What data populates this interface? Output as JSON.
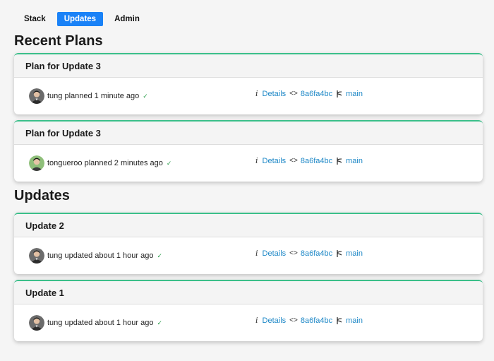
{
  "tabs": [
    {
      "label": "Stack",
      "active": false
    },
    {
      "label": "Updates",
      "active": true
    },
    {
      "label": "Admin",
      "active": false
    }
  ],
  "recent_plans": {
    "title": "Recent Plans",
    "items": [
      {
        "title": "Plan for Update 3",
        "activity": "tung planned 1 minute ago",
        "details_label": "Details",
        "commit": "8a6fa4bc",
        "branch": "main"
      },
      {
        "title": "Plan for Update 3",
        "activity": "tongueroo planned 2 minutes ago",
        "details_label": "Details",
        "commit": "8a6fa4bc",
        "branch": "main"
      }
    ]
  },
  "updates": {
    "title": "Updates",
    "items": [
      {
        "title": "Update 2",
        "activity": "tung updated about 1 hour ago",
        "details_label": "Details",
        "commit": "8a6fa4bc",
        "branch": "main"
      },
      {
        "title": "Update 1",
        "activity": "tung updated about 1 hour ago",
        "details_label": "Details",
        "commit": "8a6fa4bc",
        "branch": "main"
      }
    ]
  },
  "icons": {
    "info": "info-icon",
    "code": "code-icon",
    "branch": "git-branch-icon",
    "check": "check-icon"
  },
  "colors": {
    "accent_tab": "#1a82f7",
    "card_border": "#3bbf8a",
    "link": "#1e88c7",
    "check": "#2a9d4a"
  }
}
